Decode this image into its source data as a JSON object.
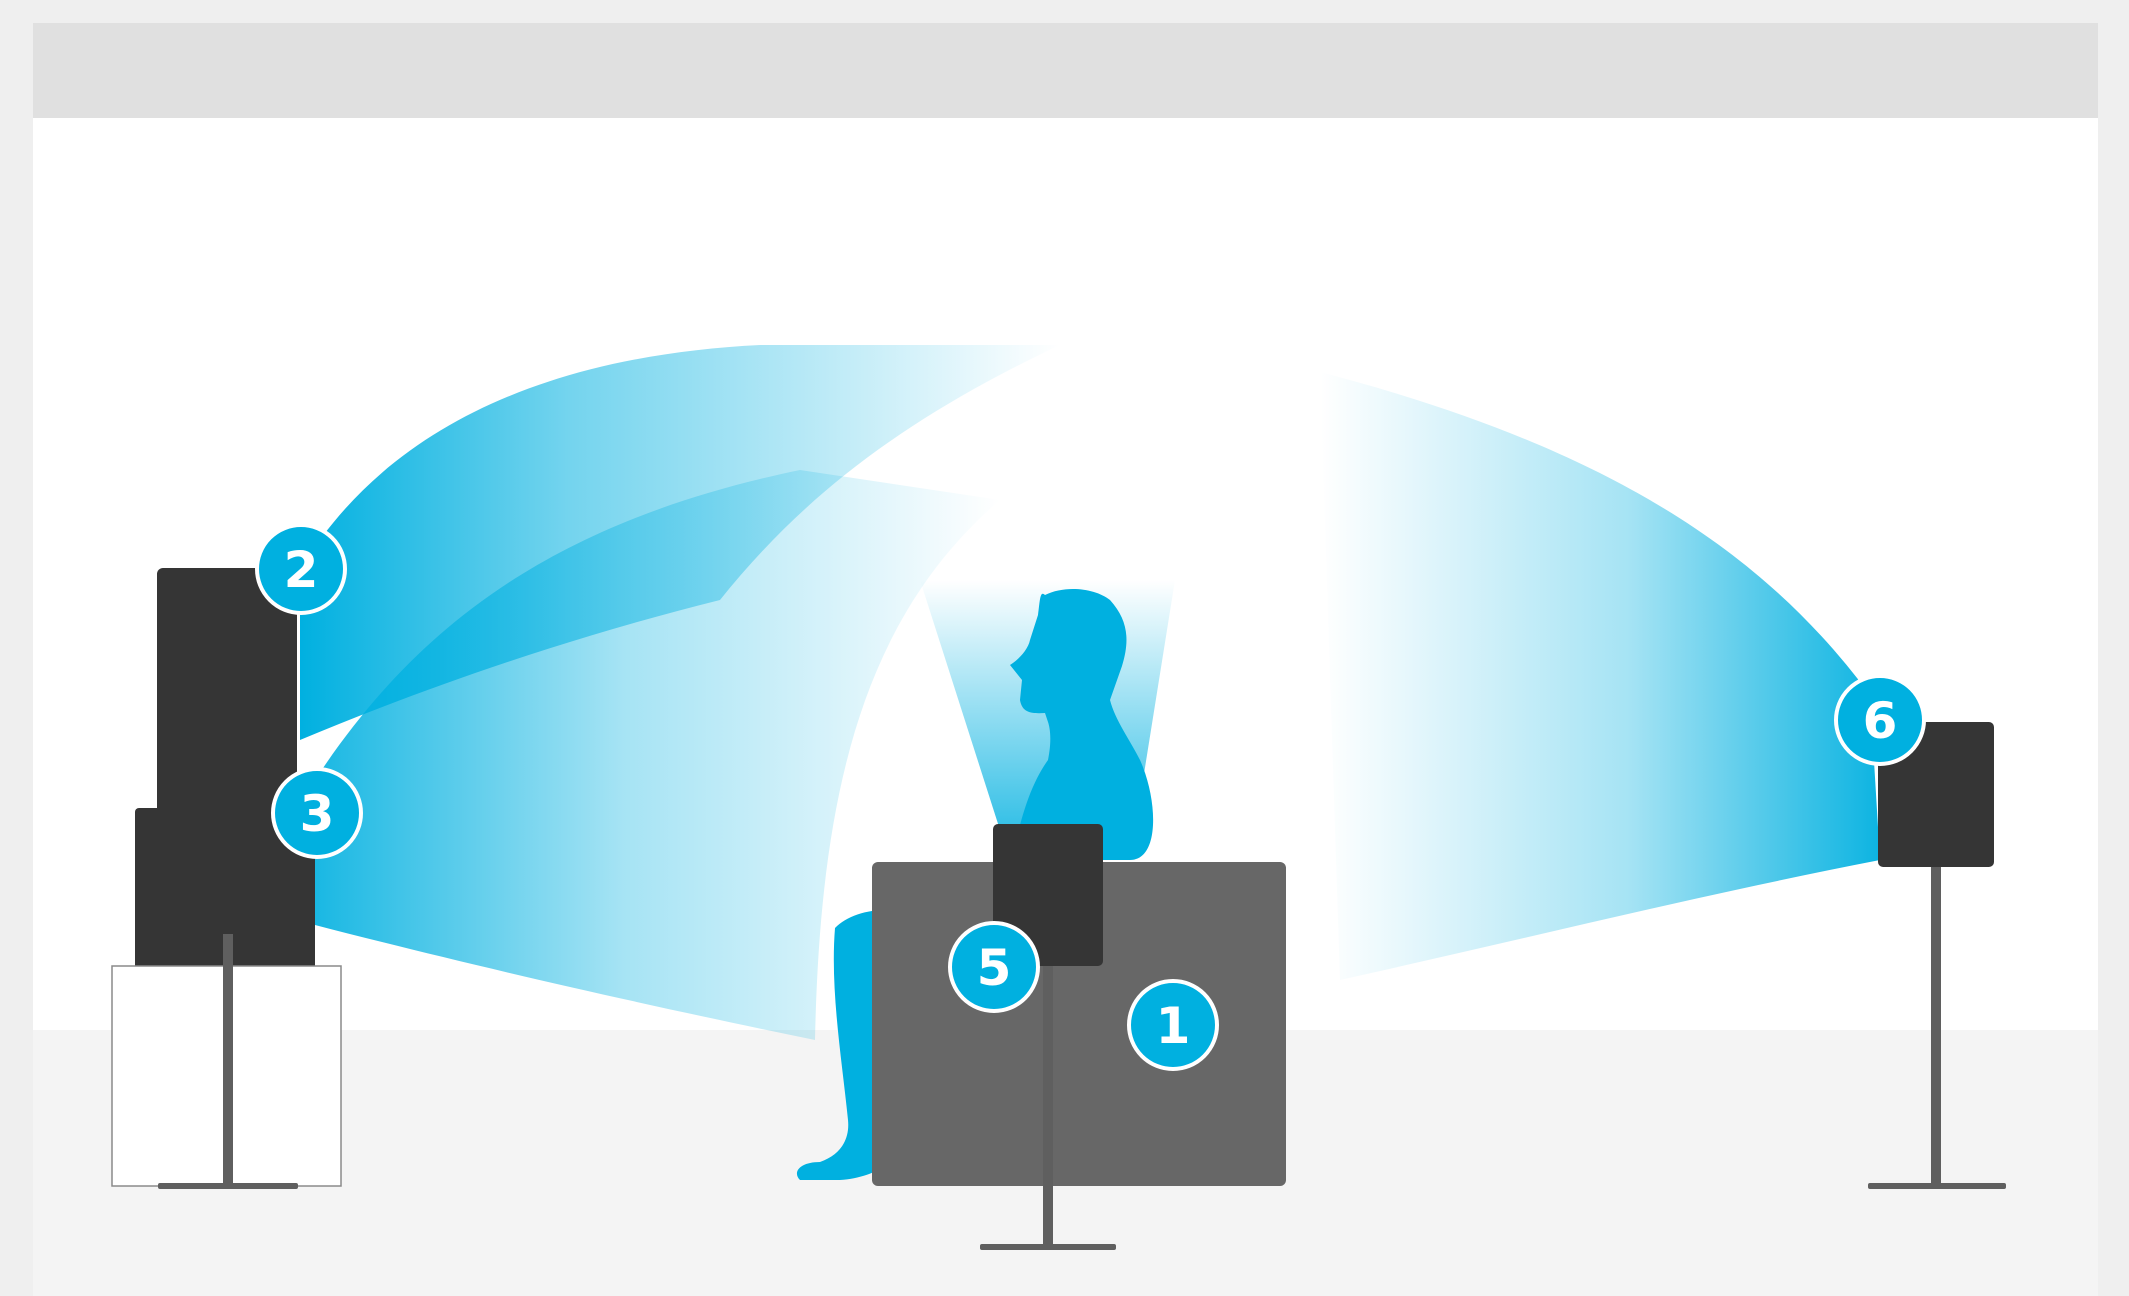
{
  "diagram": {
    "accent_color": "#00b0e0",
    "speaker_color": "#353535",
    "chair_color": "#676767",
    "stand_color": "#5f5f5f",
    "wall_color": "#ffffff",
    "floor_color": "#f4f4f4",
    "ceiling_band_color": "#e0e0e0",
    "background_color": "#efefef",
    "scene_elements": {
      "listener": "person-silhouette",
      "seat": "armchair",
      "speakers": [
        "front-speaker",
        "center-speaker",
        "rear-speaker",
        "side-speaker"
      ],
      "sound_paths": 4
    },
    "markers": [
      {
        "id": "marker-1",
        "label": "1",
        "refers_to": "armchair"
      },
      {
        "id": "marker-2",
        "label": "2",
        "refers_to": "front-speaker-top"
      },
      {
        "id": "marker-3",
        "label": "3",
        "refers_to": "front-speaker-bottom"
      },
      {
        "id": "marker-5",
        "label": "5",
        "refers_to": "side-speaker"
      },
      {
        "id": "marker-6",
        "label": "6",
        "refers_to": "rear-speaker"
      }
    ]
  }
}
